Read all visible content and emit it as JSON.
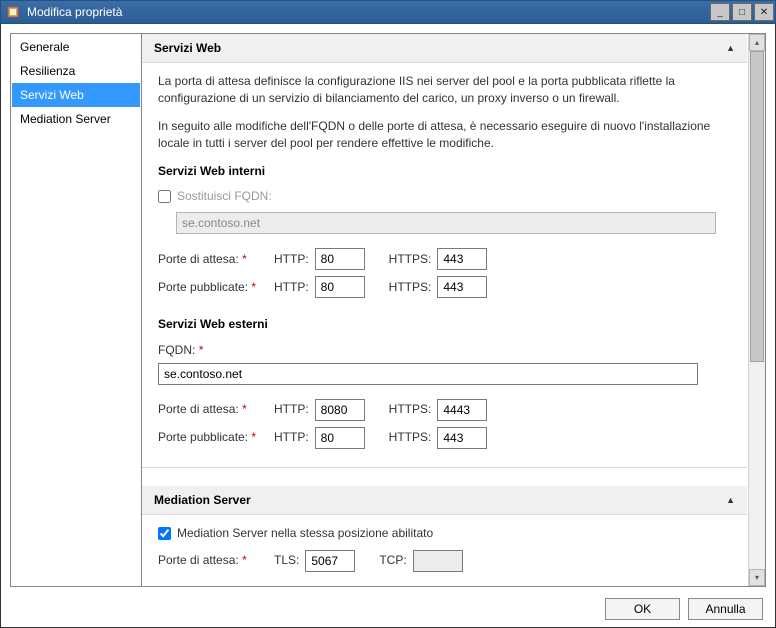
{
  "window": {
    "title": "Modifica proprietà",
    "min_icon": "_",
    "max_icon": "□",
    "close_icon": "✕"
  },
  "sidebar": {
    "items": [
      {
        "label": "Generale"
      },
      {
        "label": "Resilienza"
      },
      {
        "label": "Servizi Web"
      },
      {
        "label": "Mediation Server"
      }
    ],
    "selected_index": 2
  },
  "section1": {
    "title": "Servizi Web",
    "collapse": "▲",
    "desc1": "La porta di attesa definisce la configurazione IIS nei server del pool e la porta pubblicata riflette la configurazione di un servizio di bilanciamento del carico, un proxy inverso o un firewall.",
    "desc2": "In seguito alle modifiche dell'FQDN o delle porte di attesa, è necessario eseguire di nuovo l'installazione locale in tutti i server del pool per rendere effettive le modifiche.",
    "internal": {
      "heading": "Servizi Web interni",
      "override_label": "Sostituisci FQDN:",
      "fqdn_value": "se.contoso.net",
      "listen_label": "Porte di attesa:",
      "publish_label": "Porte pubblicate:",
      "http_label": "HTTP:",
      "https_label": "HTTPS:",
      "listen_http": "80",
      "listen_https": "443",
      "publish_http": "80",
      "publish_https": "443"
    },
    "external": {
      "heading": "Servizi Web esterni",
      "fqdn_label": "FQDN:",
      "fqdn_value": "se.contoso.net",
      "listen_label": "Porte di attesa:",
      "publish_label": "Porte pubblicate:",
      "http_label": "HTTP:",
      "https_label": "HTTPS:",
      "listen_http": "8080",
      "listen_https": "4443",
      "publish_http": "80",
      "publish_https": "443"
    }
  },
  "section2": {
    "title": "Mediation Server",
    "collapse": "▲",
    "collocated_label": "Mediation Server nella stessa posizione abilitato",
    "listen_label": "Porte di attesa:",
    "tls_label": "TLS:",
    "tcp_label": "TCP:",
    "tls_value": "5067",
    "tcp_value": ""
  },
  "buttons": {
    "ok": "OK",
    "cancel": "Annulla"
  },
  "required_mark": "*"
}
